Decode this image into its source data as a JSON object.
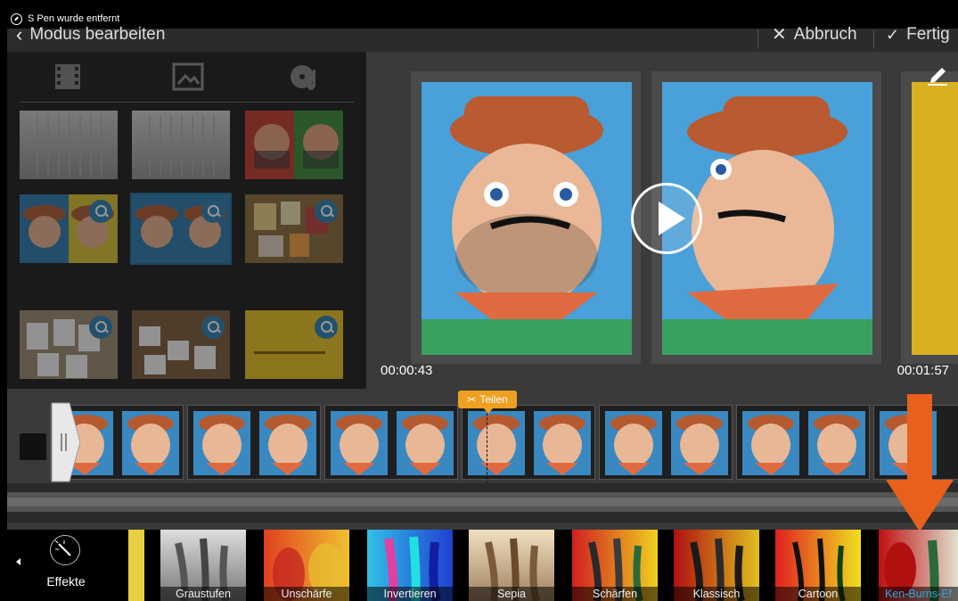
{
  "status_bar": {
    "notification": "S Pen wurde entfernt"
  },
  "action_bar": {
    "back_label": "Modus bearbeiten",
    "cancel_label": "Abbruch",
    "done_label": "Fertig"
  },
  "preview": {
    "current_time": "00:00:43",
    "total_time": "00:01:57"
  },
  "timeline": {
    "split_label": "Teilen"
  },
  "effects": {
    "label": "Effekte",
    "items": [
      "Graustufen",
      "Unschärfe",
      "Invertieren",
      "Sepia",
      "Schärfen",
      "Klassisch",
      "Cartoon",
      "Ken-Burns-Ef"
    ],
    "selected": "Ken-Burns-Ef"
  },
  "colors": {
    "accent": "#f0a020",
    "highlight": "#2fa7e0",
    "annotation_arrow": "#e8601c"
  }
}
